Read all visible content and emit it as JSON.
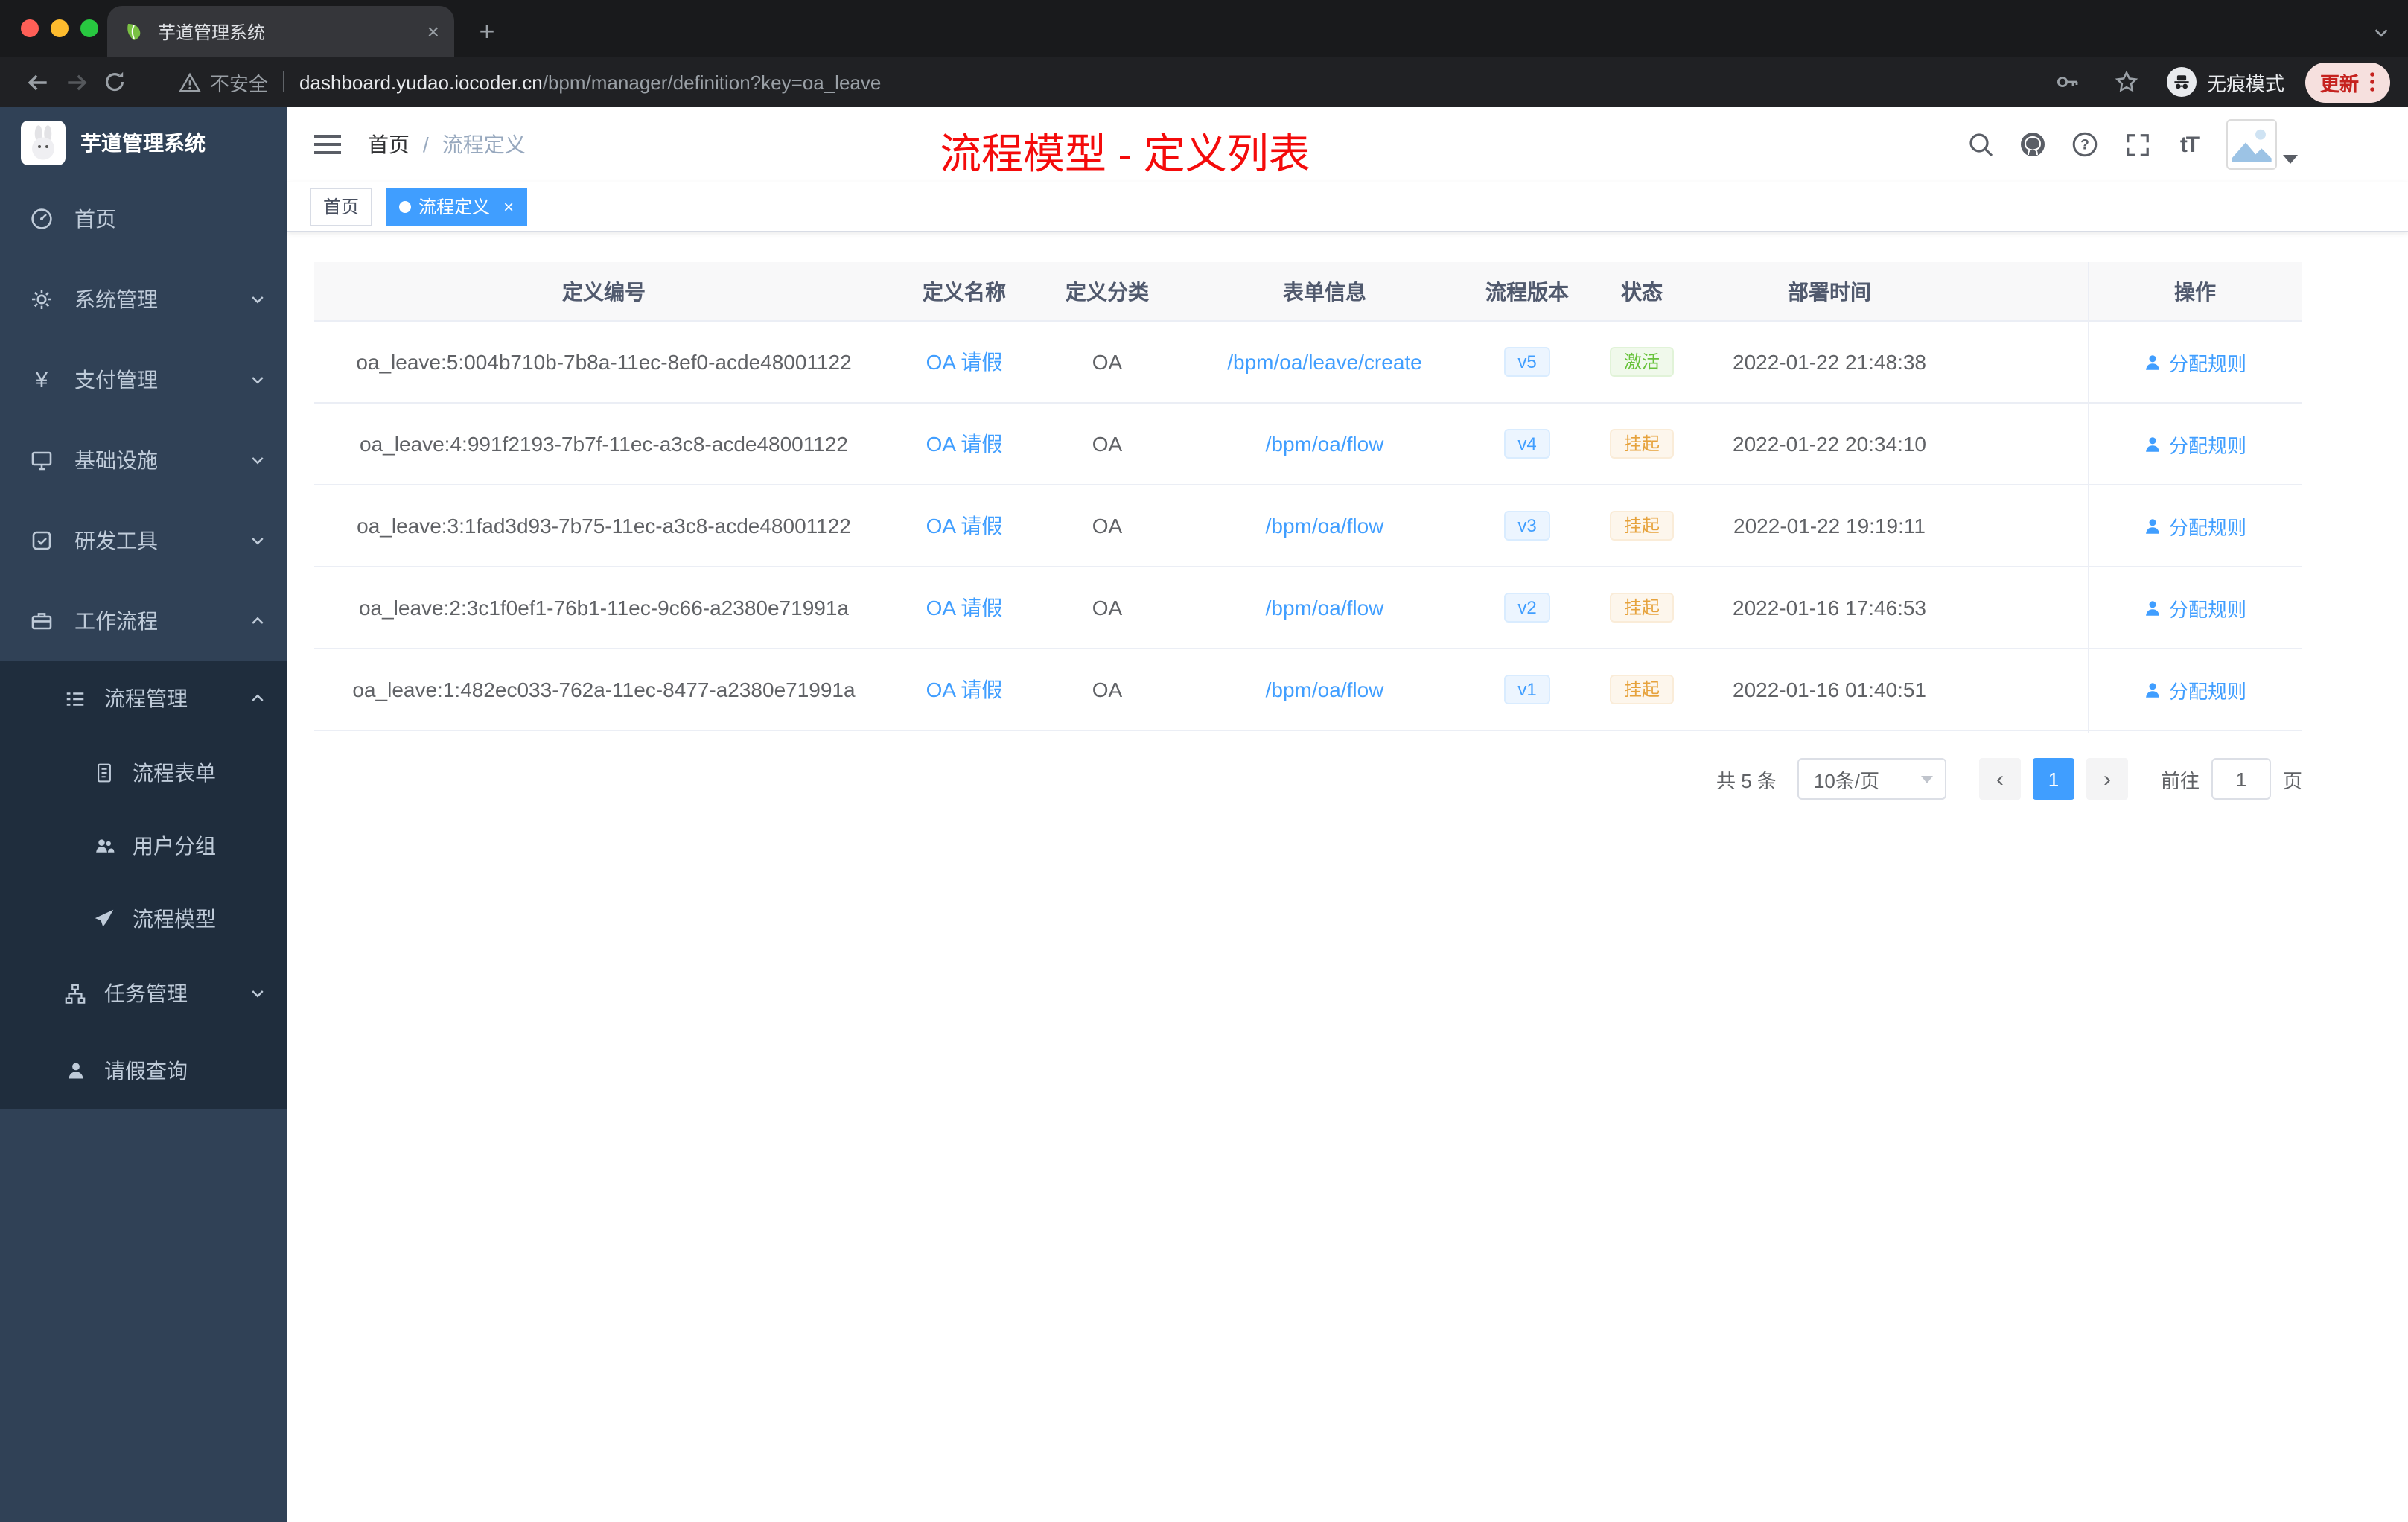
{
  "browser": {
    "tab_title": "芋道管理系统",
    "tab_close": "×",
    "new_tab": "+",
    "security_label": "不安全",
    "url_domain": "dashboard.yudao.iocoder.cn",
    "url_path": "/bpm/manager/definition?key=oa_leave",
    "incognito_label": "无痕模式",
    "update_label": "更新"
  },
  "sidebar": {
    "logo_title": "芋道管理系统",
    "items": [
      {
        "label": "首页"
      },
      {
        "label": "系统管理"
      },
      {
        "label": "支付管理"
      },
      {
        "label": "基础设施"
      },
      {
        "label": "研发工具"
      },
      {
        "label": "工作流程"
      }
    ],
    "process_group": {
      "label": "流程管理"
    },
    "process_children": [
      {
        "label": "流程表单"
      },
      {
        "label": "用户分组"
      },
      {
        "label": "流程模型"
      }
    ],
    "task_group": {
      "label": "任务管理"
    },
    "leave_item": {
      "label": "请假查询"
    }
  },
  "navbar": {
    "breadcrumb_home": "首页",
    "breadcrumb_separator": "/",
    "breadcrumb_current": "流程定义",
    "font_size_icon": "tT"
  },
  "annotation": {
    "text": "流程模型 - 定义列表",
    "color": "#f40b0b"
  },
  "tags": {
    "home": "首页",
    "active": "流程定义",
    "close": "×"
  },
  "table": {
    "headers": [
      "定义编号",
      "定义名称",
      "定义分类",
      "表单信息",
      "流程版本",
      "状态",
      "部署时间",
      "操作"
    ],
    "rows": [
      {
        "id": "oa_leave:5:004b710b-7b8a-11ec-8ef0-acde48001122",
        "name": "OA 请假",
        "category": "OA",
        "form": "/bpm/oa/leave/create",
        "version": "v5",
        "status": "激活",
        "status_type": "success",
        "time": "2022-01-22 21:48:38",
        "action": "分配规则"
      },
      {
        "id": "oa_leave:4:991f2193-7b7f-11ec-a3c8-acde48001122",
        "name": "OA 请假",
        "category": "OA",
        "form": "/bpm/oa/flow",
        "version": "v4",
        "status": "挂起",
        "status_type": "warning",
        "time": "2022-01-22 20:34:10",
        "action": "分配规则"
      },
      {
        "id": "oa_leave:3:1fad3d93-7b75-11ec-a3c8-acde48001122",
        "name": "OA 请假",
        "category": "OA",
        "form": "/bpm/oa/flow",
        "version": "v3",
        "status": "挂起",
        "status_type": "warning",
        "time": "2022-01-22 19:19:11",
        "action": "分配规则"
      },
      {
        "id": "oa_leave:2:3c1f0ef1-76b1-11ec-9c66-a2380e71991a",
        "name": "OA 请假",
        "category": "OA",
        "form": "/bpm/oa/flow",
        "version": "v2",
        "status": "挂起",
        "status_type": "warning",
        "time": "2022-01-16 17:46:53",
        "action": "分配规则"
      },
      {
        "id": "oa_leave:1:482ec033-762a-11ec-8477-a2380e71991a",
        "name": "OA 请假",
        "category": "OA",
        "form": "/bpm/oa/flow",
        "version": "v1",
        "status": "挂起",
        "status_type": "warning",
        "time": "2022-01-16 01:40:51",
        "action": "分配规则"
      }
    ]
  },
  "pagination": {
    "total": "共 5 条",
    "page_size": "10条/页",
    "prev": "‹",
    "next": "›",
    "current_page": "1",
    "goto_label": "前往",
    "goto_value": "1",
    "unit": "页"
  },
  "colors": {
    "accent_blue": "#409eff",
    "success_green": "#67c23a",
    "warning_orange": "#e6a23c",
    "sidebar_bg": "#304156",
    "submenu_bg": "#1f2d3d"
  }
}
